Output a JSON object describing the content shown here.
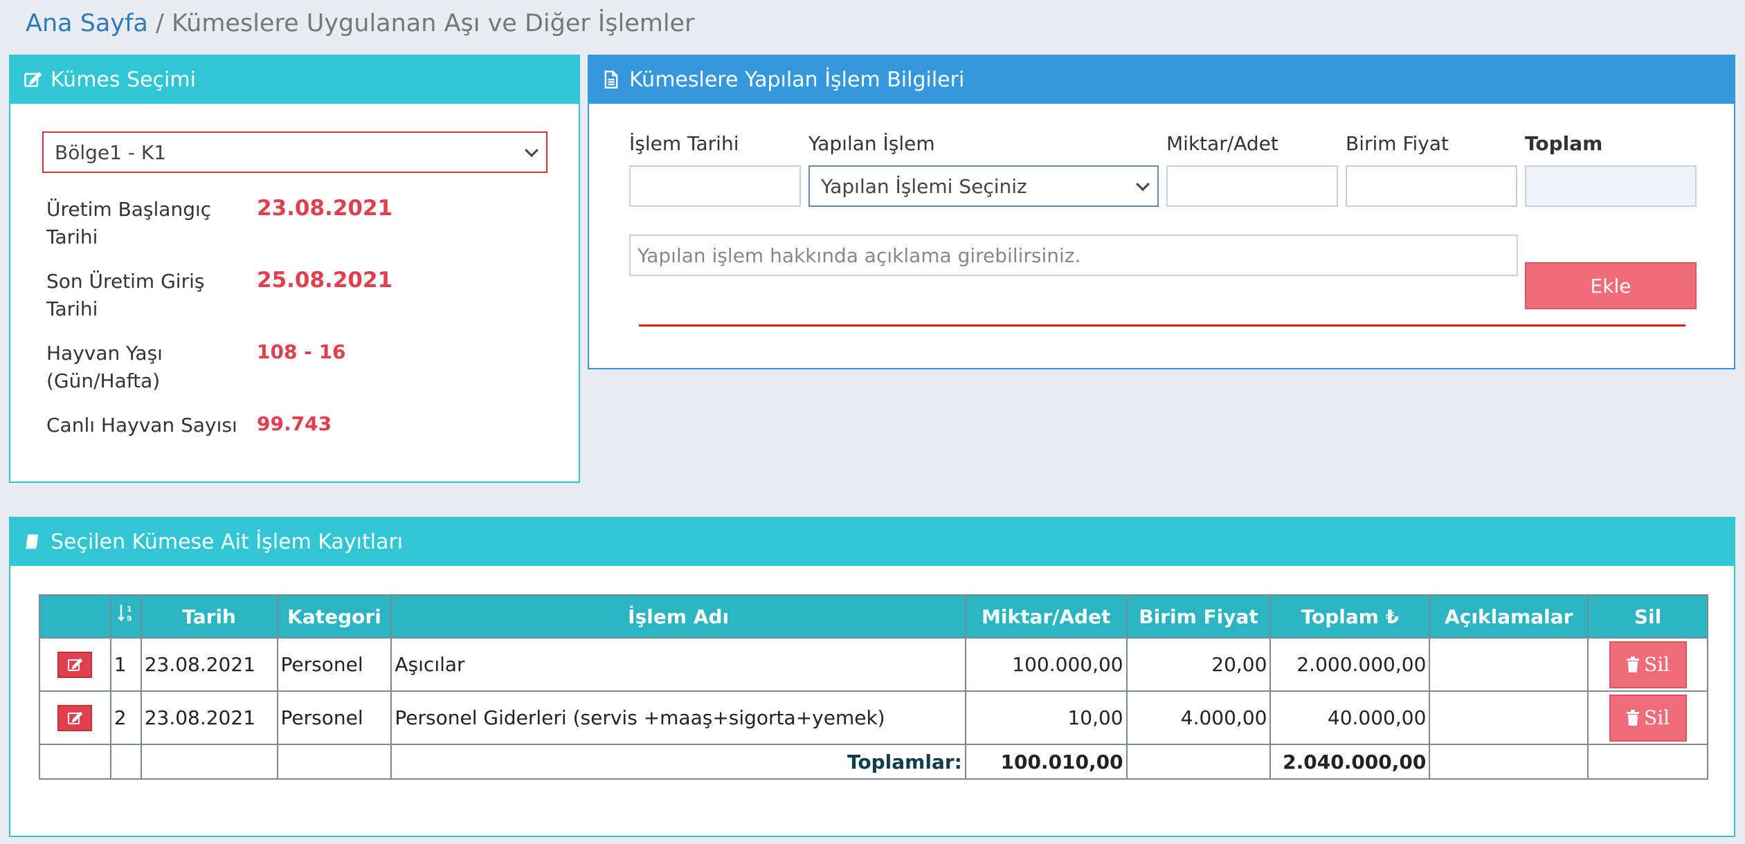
{
  "breadcrumb": {
    "home": "Ana Sayfa",
    "separator": "/",
    "current": "Kümeslere Uygulanan Aşı ve Diğer İşlemler"
  },
  "kumes_panel": {
    "title": "Kümes Seçimi",
    "select_value": "Bölge1 - K1",
    "rows": [
      {
        "label": "Üretim Başlangıç Tarihi",
        "value": "23.08.2021"
      },
      {
        "label": "Son Üretim Giriş Tarihi",
        "value": "25.08.2021"
      },
      {
        "label": "Hayvan Yaşı (Gün/Hafta)",
        "value": "108 - 16"
      },
      {
        "label": "Canlı Hayvan Sayısı",
        "value": "99.743"
      }
    ]
  },
  "islem_panel": {
    "title": "Kümeslere Yapılan İşlem Bilgileri",
    "labels": {
      "tarih": "İşlem Tarihi",
      "islem": "Yapılan İşlem",
      "miktar": "Miktar/Adet",
      "fiyat": "Birim Fiyat",
      "toplam": "Toplam"
    },
    "islem_select_value": "Yapılan İşlemi Seçiniz",
    "description_placeholder": "Yapılan işlem hakkında açıklama girebilirsiniz.",
    "add_label": "Ekle"
  },
  "kayit_panel": {
    "title": "Seçilen Kümese Ait İşlem Kayıtları",
    "columns": [
      "",
      "",
      "Tarih",
      "Kategori",
      "İşlem Adı",
      "Miktar/Adet",
      "Birim Fiyat",
      "Toplam ₺",
      "Açıklamalar",
      "Sil"
    ],
    "rows": [
      {
        "no": "1",
        "tarih": "23.08.2021",
        "kategori": "Personel",
        "islem": "Aşıcılar",
        "miktar": "100.000,00",
        "fiyat": "20,00",
        "toplam": "2.000.000,00",
        "aciklama": ""
      },
      {
        "no": "2",
        "tarih": "23.08.2021",
        "kategori": "Personel",
        "islem": "Personel Giderleri (servis +maaş+sigorta+yemek)",
        "miktar": "10,00",
        "fiyat": "4.000,00",
        "toplam": "40.000,00",
        "aciklama": ""
      }
    ],
    "totals": {
      "label": "Toplamlar:",
      "miktar": "100.010,00",
      "toplam": "2.040.000,00"
    },
    "delete_label": "Sil"
  },
  "colors": {
    "teal": "#31c6d4",
    "blue": "#3698dc",
    "red": "#e0404e",
    "pink": "#ef6c78"
  }
}
